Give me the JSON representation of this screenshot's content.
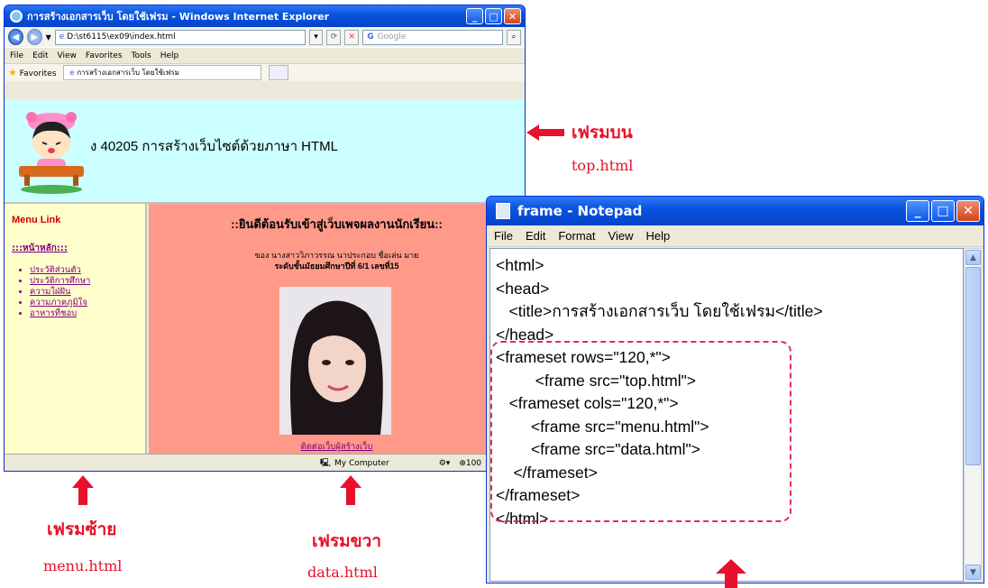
{
  "ie": {
    "title": "การสร้างเอกสารเว็บ โดยใช้เฟรม - Windows Internet Explorer",
    "address": "D:\\st6115\\ex09\\index.html",
    "search_placeholder": "Google",
    "menu": [
      "File",
      "Edit",
      "View",
      "Favorites",
      "Tools",
      "Help"
    ],
    "favorites_label": "Favorites",
    "tab_label": "การสร้างเอกสารเว็บ โดยใช้เฟรม",
    "top_frame_text": "ง 40205 การสร้างเว็บไซต์ด้วยภาษา HTML",
    "menu_frame": {
      "title": "Menu Link",
      "home": ":::หน้าหลัก:::",
      "links": [
        "ประวัติส่วนตัว",
        "ประวัติการศึกษา",
        "ความใฝ่ฝัน",
        "ความภาคภูมิใจ",
        "อาหารที่ชอบ"
      ]
    },
    "data_frame": {
      "title": "::ยินดีต้อนรับเข้าสู่เว็บเพจผลงานนักเรียน::",
      "line1": "ของ นางสาววิภาวรรณ นาประกอบ ชื่อเล่น มาย",
      "line2": "ระดับชั้นมัธยมศึกษาปีที่ 6/1 เลขที่15",
      "contact": "ติดต่อเว็บผู้สร้างเว็บ"
    },
    "status": {
      "zone": "My Computer",
      "zoom": "100"
    }
  },
  "notepad": {
    "title": "frame - Notepad",
    "menu": [
      "File",
      "Edit",
      "Format",
      "View",
      "Help"
    ],
    "code": "<html>\n<head>\n   <title>การสร้างเอกสารเว็บ โดยใช้เฟรม</title>\n</head>\n<frameset rows=\"120,*\">\n         <frame src=\"top.html\">\n   <frameset cols=\"120,*\">\n        <frame src=\"menu.html\">\n        <frame src=\"data.html\">\n    </frameset>\n</frameset>\n</html>"
  },
  "annotations": {
    "top": {
      "label": "เฟรมบน",
      "file": "top.html"
    },
    "left": {
      "label": "เฟรมซ้าย",
      "file": "menu.html"
    },
    "right": {
      "label": "เฟรมขวา",
      "file": "data.html"
    }
  },
  "colors": {
    "annotation_red": "#e8102a",
    "top_frame_bg": "#ccffff",
    "menu_frame_bg": "#ffffcc",
    "data_frame_bg": "#ff9a8a"
  }
}
